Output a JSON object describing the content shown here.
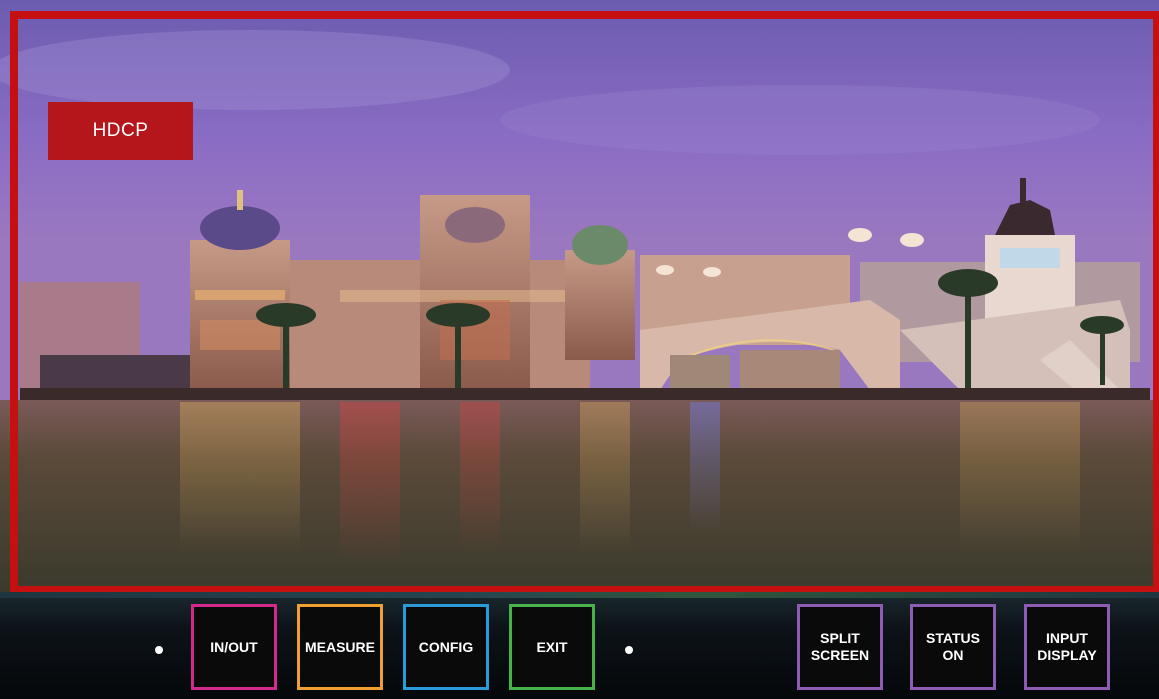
{
  "overlay": {
    "hdcp_label": "HDCP",
    "frame_color": "#c41010",
    "badge_color": "#b4161b"
  },
  "photo": {
    "description_icon": "landscape-photo"
  },
  "controls": {
    "buttons": [
      {
        "id": "inout",
        "label": "IN/OUT",
        "color": "#d3298c"
      },
      {
        "id": "measure",
        "label": "MEASURE",
        "color": "#f0a030"
      },
      {
        "id": "config",
        "label": "CONFIG",
        "color": "#2c9ad8"
      },
      {
        "id": "exit",
        "label": "EXIT",
        "color": "#47b24a"
      },
      {
        "id": "split",
        "label": "SPLIT\nSCREEN",
        "color": "#8e5bb5"
      },
      {
        "id": "status",
        "label": "STATUS\nON",
        "color": "#8e5bb5"
      },
      {
        "id": "input",
        "label": "INPUT\nDISPLAY",
        "color": "#8e5bb5"
      }
    ]
  }
}
